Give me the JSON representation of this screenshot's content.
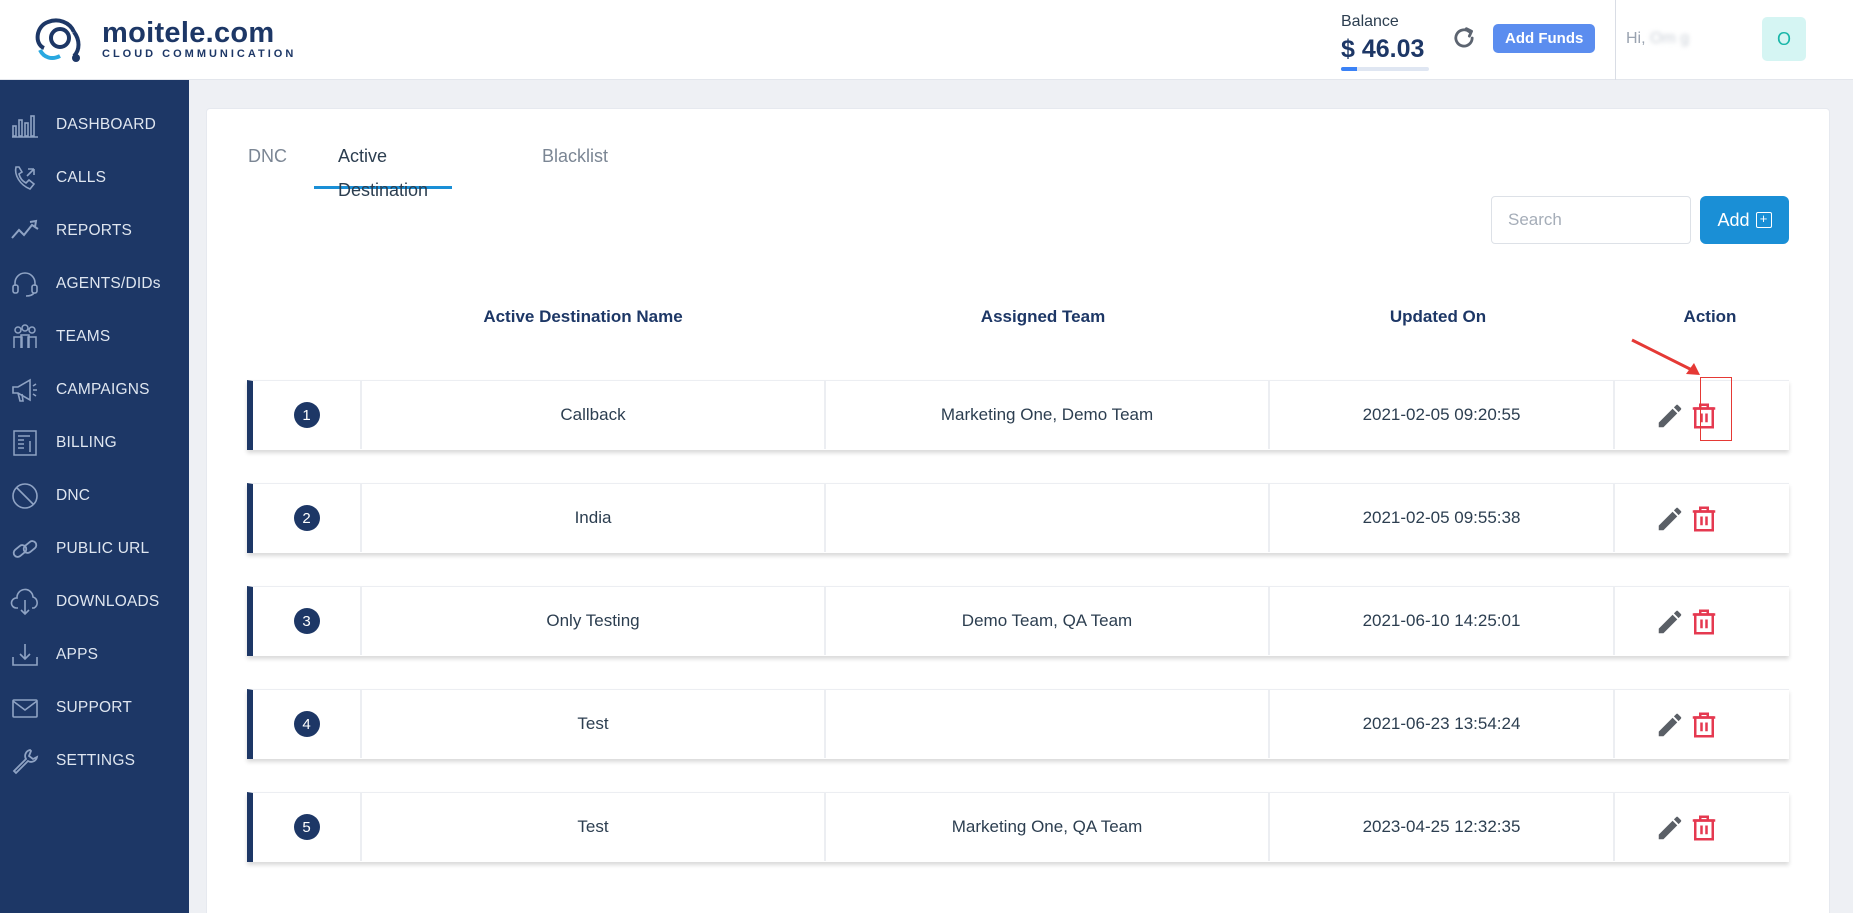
{
  "brand": {
    "name": "moitele.com",
    "tagline": "CLOUD COMMUNICATION"
  },
  "header": {
    "balance_label": "Balance",
    "balance_value": "$ 46.03",
    "balance_progress": 0.18,
    "add_funds_label": "Add Funds",
    "greeting_prefix": "Hi, ",
    "greeting_name": "Om     g",
    "avatar_initial": "O"
  },
  "sidebar": {
    "items": [
      {
        "label": "DASHBOARD",
        "icon": "dashboard-icon"
      },
      {
        "label": "CALLS",
        "icon": "calls-icon"
      },
      {
        "label": "REPORTS",
        "icon": "reports-icon"
      },
      {
        "label": "AGENTS/DIDs",
        "icon": "headset-icon"
      },
      {
        "label": "TEAMS",
        "icon": "teams-icon"
      },
      {
        "label": "CAMPAIGNS",
        "icon": "megaphone-icon"
      },
      {
        "label": "BILLING",
        "icon": "billing-icon"
      },
      {
        "label": "DNC",
        "icon": "block-icon"
      },
      {
        "label": "PUBLIC URL",
        "icon": "link-icon"
      },
      {
        "label": "DOWNLOADS",
        "icon": "cloud-download-icon"
      },
      {
        "label": "APPS",
        "icon": "download-tray-icon"
      },
      {
        "label": "SUPPORT",
        "icon": "mail-icon"
      },
      {
        "label": "SETTINGS",
        "icon": "wrench-icon"
      }
    ]
  },
  "tabs": [
    {
      "label": "DNC",
      "active": false
    },
    {
      "label": "Active Destination",
      "active": true
    },
    {
      "label": "Blacklist",
      "active": false
    }
  ],
  "search": {
    "placeholder": "Search",
    "value": ""
  },
  "add_button_label": "Add",
  "table": {
    "columns": [
      "Active Destination Name",
      "Assigned Team",
      "Updated On",
      "Action"
    ],
    "rows": [
      {
        "index": "1",
        "name": "Callback",
        "team": "Marketing One, Demo Team",
        "updated": "2021-02-05 09:20:55"
      },
      {
        "index": "2",
        "name": "India",
        "team": "",
        "updated": "2021-02-05 09:55:38"
      },
      {
        "index": "3",
        "name": "Only Testing",
        "team": "Demo Team, QA Team",
        "updated": "2021-06-10 14:25:01"
      },
      {
        "index": "4",
        "name": "Test",
        "team": "",
        "updated": "2021-06-23 13:54:24"
      },
      {
        "index": "5",
        "name": "Test",
        "team": "Marketing One, QA Team",
        "updated": "2023-04-25 12:32:35"
      }
    ]
  },
  "colors": {
    "sidebar_bg": "#1d3766",
    "accent": "#1a8fd6",
    "add_funds": "#5b8def",
    "delete": "#e53950",
    "annotation": "#e53935"
  }
}
